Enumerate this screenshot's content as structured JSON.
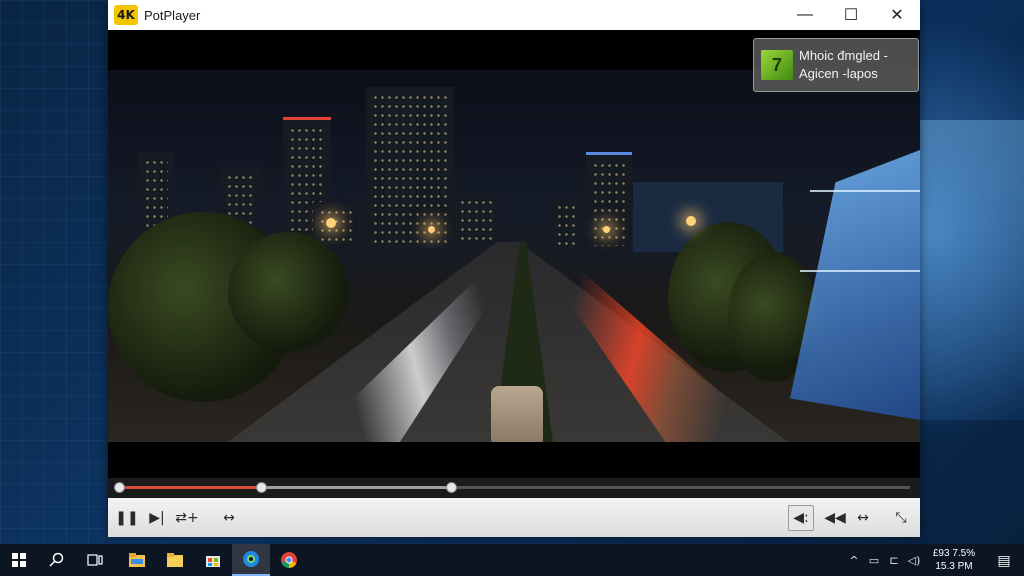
{
  "window": {
    "app_logo_text": "4K",
    "title": "PotPlayer",
    "minimize_glyph": "—",
    "maximize_glyph": "☐",
    "close_glyph": "✕"
  },
  "notification": {
    "icon_glyph": "7",
    "line1": "Mhoic đmgled -",
    "line2": "Agicen -lapos"
  },
  "playback": {
    "played_fraction": 0.18,
    "buffered_fraction": 0.42,
    "knob_fraction": 0.18
  },
  "controls": {
    "pause_glyph": "❚❚",
    "next_glyph": "▶|",
    "shuffle_glyph": "⇄+",
    "repeat_glyph": "↔",
    "volume_glyph": "◀:",
    "prev_glyph": "◀◀",
    "aspect_glyph": "↔",
    "fullscreen_glyph": "⤡"
  },
  "taskbar": {
    "start_glyph": "⊞",
    "search_glyph": "⌕",
    "task_view_glyph": "⧉",
    "apps": [
      "file-explorer",
      "folder",
      "store",
      "edge",
      "chrome"
    ],
    "tray": {
      "chevron_glyph": "^",
      "network_glyph": "▭",
      "battery_glyph": "⊏",
      "volume_glyph": "◁)",
      "clock_line1": "£93 7.5%",
      "clock_line2": "15.3 PM",
      "notification_glyph": "▤"
    }
  },
  "colors": {
    "seek_played": "#d84a3a",
    "taskbar_bg": "#0c1522",
    "logo_yellow": "#f5c400"
  }
}
